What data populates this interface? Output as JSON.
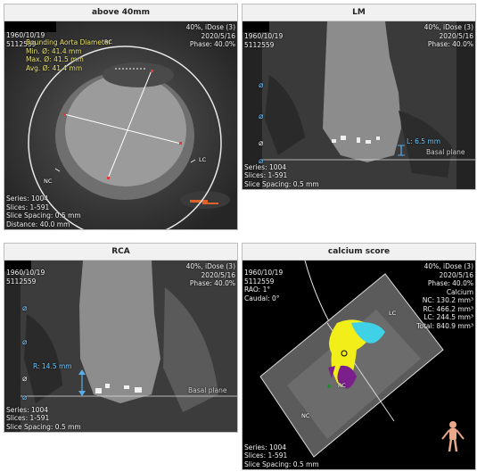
{
  "panels": {
    "above": {
      "title": "above 40mm",
      "dob": "1960/10/19",
      "id": "5112559",
      "dose": "40%, iDose (3)",
      "date": "2020/5/16",
      "phase": "Phase: 40.0%",
      "aorta_label": "Bounding Aorta Diameter",
      "min": "Min. Ø: 41.4 mm",
      "max": "Max. Ø: 41.5 mm",
      "avg": "Avg. Ø: 41.4 mm",
      "series": "Series: 1004",
      "slices": "Slices: 1-591",
      "spacing": "Slice Spacing: 0.5 mm",
      "distance": "Distance: 40.0 mm",
      "rc": "RC",
      "lc": "LC",
      "nc": "NC"
    },
    "lm": {
      "title": "LM",
      "dob": "1960/10/19",
      "id": "5112559",
      "dose": "40%, iDose (3)",
      "date": "2020/5/16",
      "phase": "Phase: 40.0%",
      "measure": "L: 6.5 mm",
      "basal": "Basal plane",
      "series": "Series: 1004",
      "slices": "Slices: 1-591",
      "spacing": "Slice Spacing: 0.5 mm"
    },
    "rca": {
      "title": "RCA",
      "dob": "1960/10/19",
      "id": "5112559",
      "dose": "40%, iDose (3)",
      "date": "2020/5/16",
      "phase": "Phase: 40.0%",
      "measure": "R: 14.5 mm",
      "basal": "Basal plane",
      "series": "Series: 1004",
      "slices": "Slices: 1-591",
      "spacing": "Slice Spacing: 0.5 mm"
    },
    "calcium": {
      "title": "calcium score",
      "dob": "1960/10/19",
      "id": "5112559",
      "rao": "RAO: 1°",
      "caudal": "Caudal: 0°",
      "dose": "40%, iDose (3)",
      "date": "2020/5/16",
      "phase": "Phase: 40.0%",
      "calcium": "Calcium",
      "nc": "NC: 130.2 mm³",
      "rc": "RC: 466.2 mm³",
      "lc": "LC: 244.5 mm³",
      "total": "Total: 840.9 mm³",
      "lc_marker": "LC",
      "rc_marker": "RC",
      "nc_marker": "NC",
      "series": "Series: 1004",
      "slices": "Slices: 1-591",
      "spacing": "Slice Spacing: 0.5 mm"
    }
  },
  "colors": {
    "yellow": "#f2ee1a",
    "cyan": "#3fd1e6",
    "purple": "#7a1f8c",
    "measure_blue": "#5aaee8",
    "calipers": "#e7e26a"
  },
  "icons": [
    "diameter-icon"
  ]
}
